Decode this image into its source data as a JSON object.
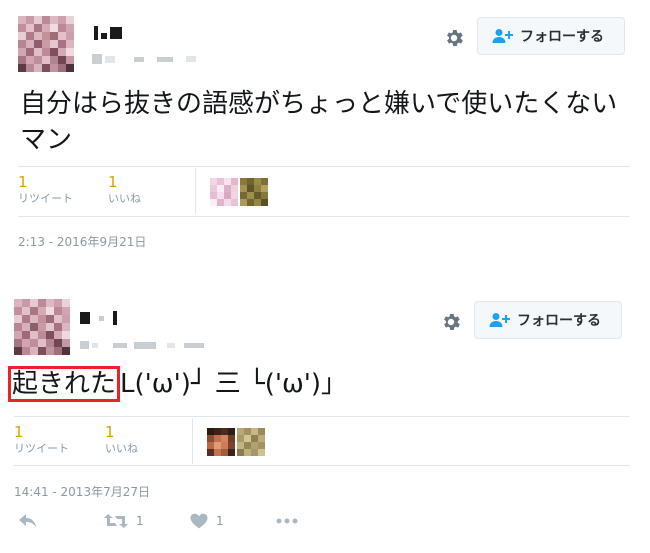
{
  "tweet1": {
    "follow_label": "フォローする",
    "text": "自分はら抜きの語感がちょっと嫌いで使いたくないマン",
    "retweet_count": "1",
    "retweet_label": "リツイート",
    "like_count": "1",
    "like_label": "いいね",
    "timestamp": "2:13 - 2016年9月21日"
  },
  "tweet2": {
    "follow_label": "フォローする",
    "text_highlight": "起きれた",
    "text_rest": "L('ω')┘ 三 └('ω')」",
    "retweet_count": "1",
    "retweet_label": "リツイート",
    "like_count": "1",
    "like_label": "いいね",
    "timestamp": "14:41 - 2013年7月27日",
    "actions": {
      "retweet_count": "1",
      "like_count": "1"
    }
  },
  "colors": {
    "accent_count": "#e0a000",
    "muted": "#8899a6",
    "highlight_box": "#e8232a",
    "divider": "#e1e8ed"
  },
  "icons": [
    "gear-icon",
    "follow-user-plus-icon",
    "reply-icon",
    "retweet-icon",
    "heart-icon",
    "more-icon"
  ]
}
